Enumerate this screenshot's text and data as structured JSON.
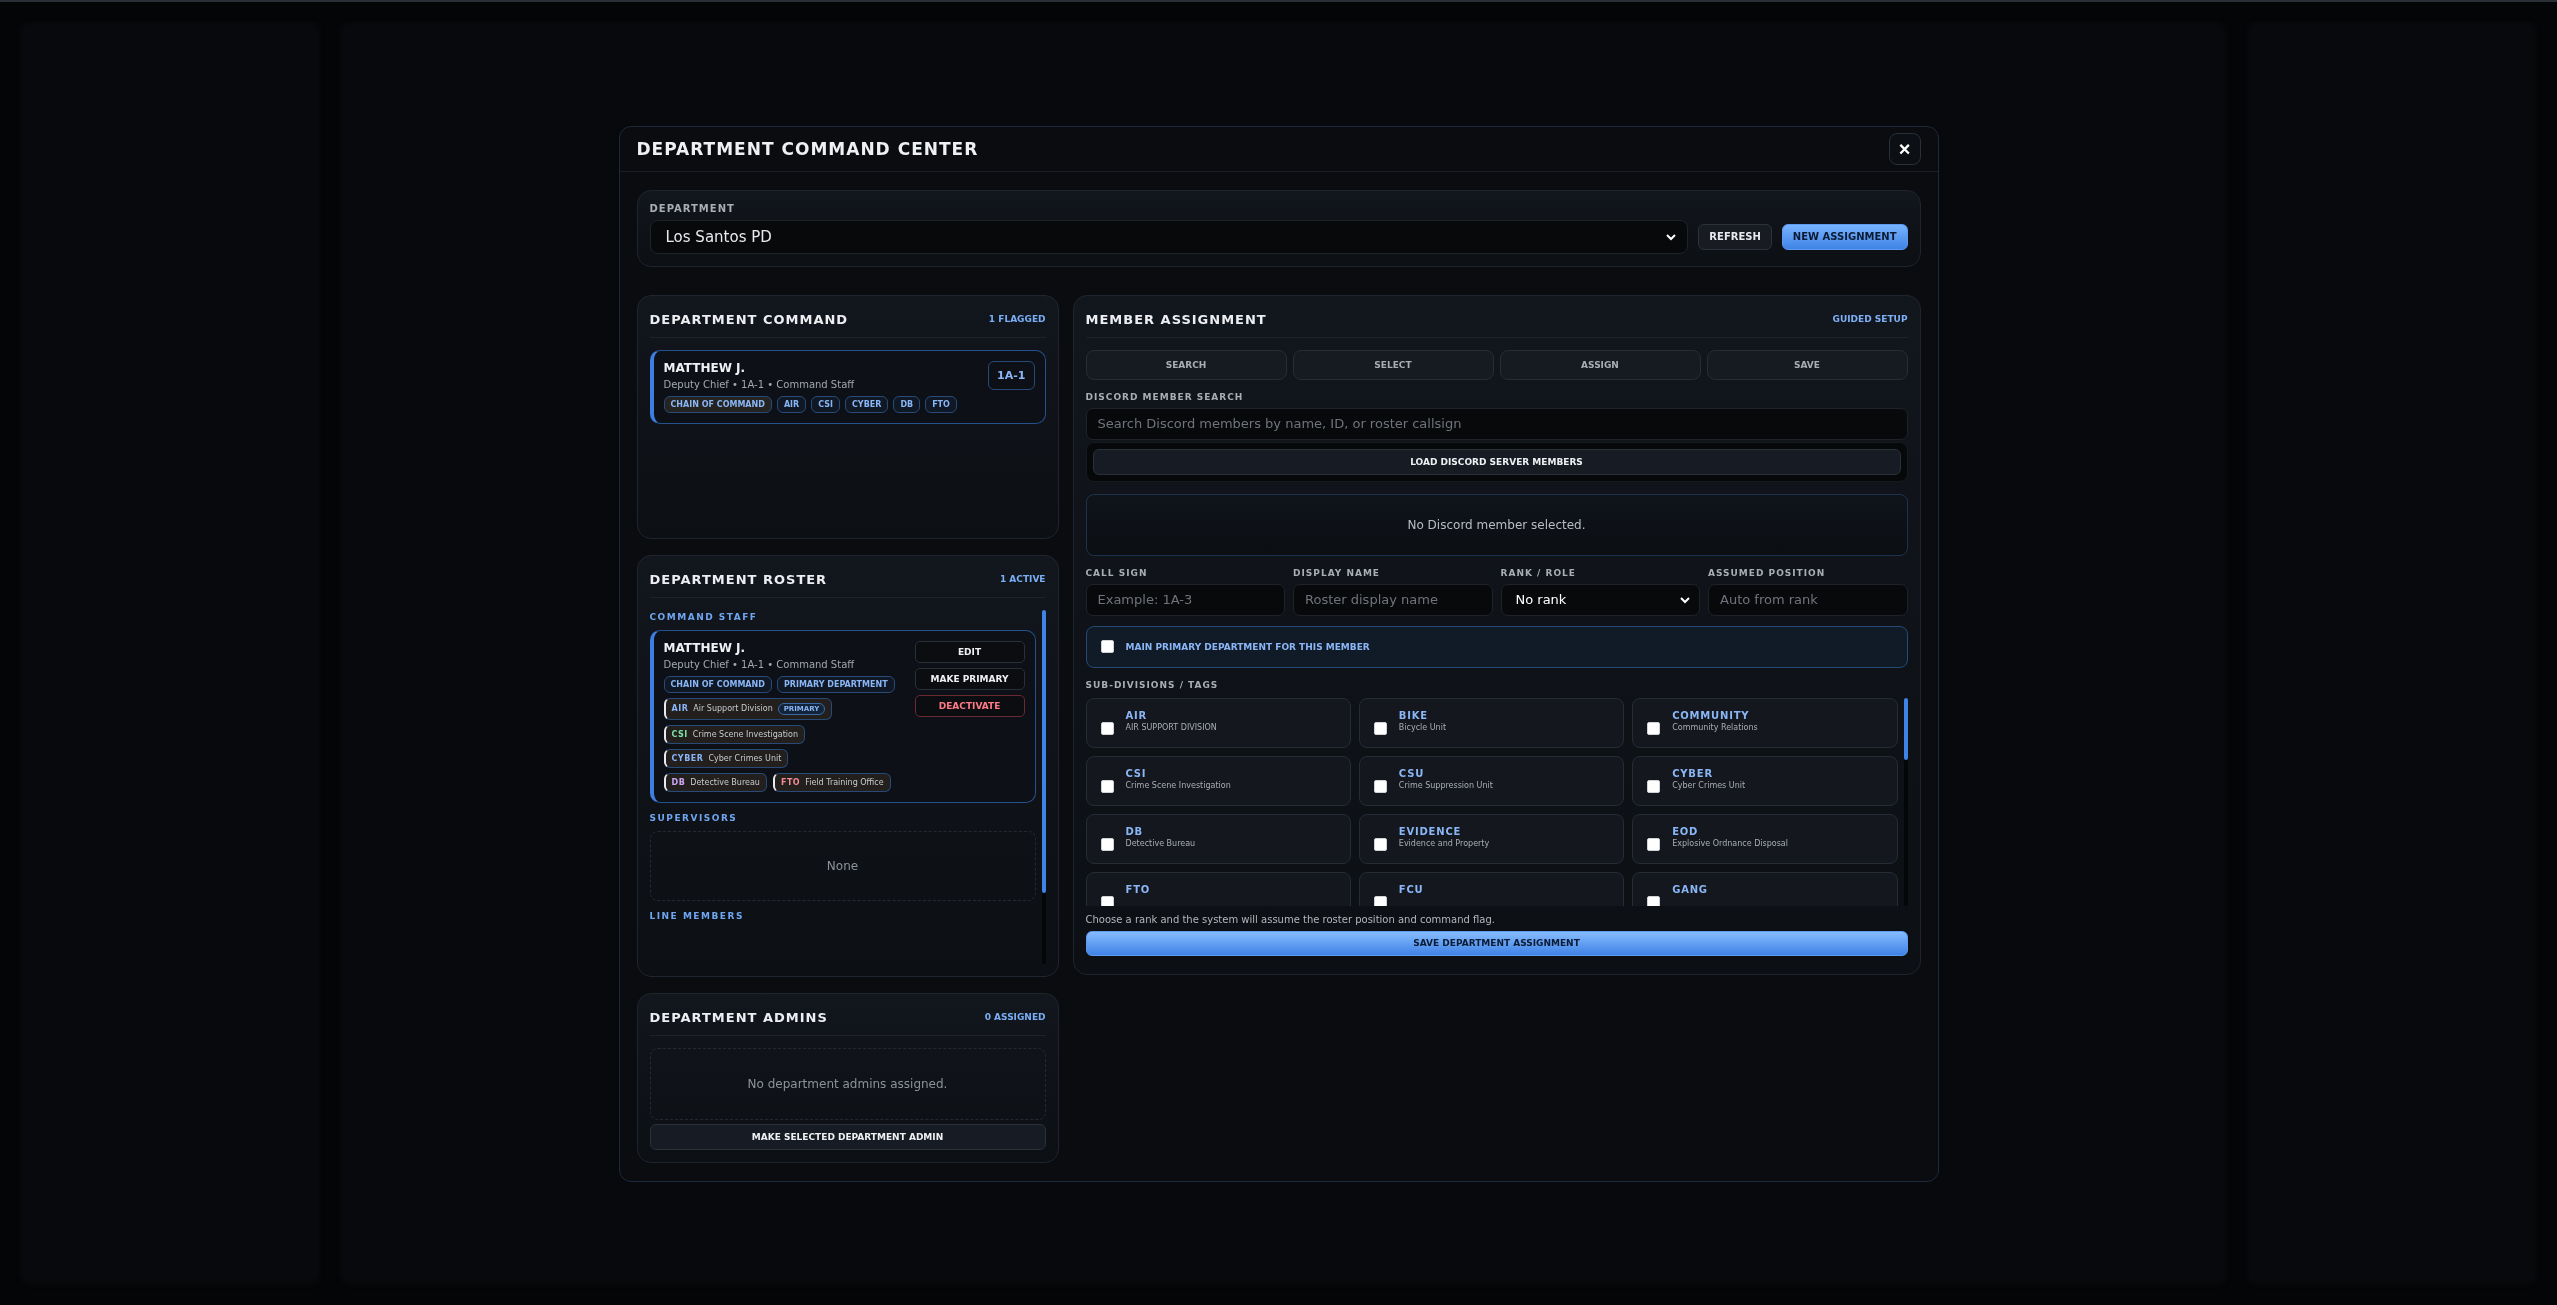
{
  "modal": {
    "title": "DEPARTMENT COMMAND CENTER",
    "close": "×"
  },
  "department": {
    "label": "DEPARTMENT",
    "value": "Los Santos PD",
    "buttons": [
      {
        "label": "REFRESH",
        "kind": "secondary"
      },
      {
        "label": "NEW ASSIGNMENT",
        "kind": "primary"
      }
    ]
  },
  "command": {
    "title": "DEPARTMENT COMMAND",
    "count": "1 FLAGGED",
    "members": [
      {
        "name": "MATTHEW J.",
        "subtitle": "Deputy Chief • 1A-1 • Command Staff",
        "callsign": "1A-1",
        "tags": [
          {
            "label": "CHAIN OF COMMAND",
            "kind": "flag"
          },
          {
            "label": "AIR",
            "kind": "division"
          },
          {
            "label": "CSI",
            "kind": "division"
          },
          {
            "label": "CYBER",
            "kind": "division"
          },
          {
            "label": "DB",
            "kind": "division"
          },
          {
            "label": "FTO",
            "kind": "division"
          }
        ]
      }
    ]
  },
  "roster": {
    "title": "DEPARTMENT ROSTER",
    "count": "1 ACTIVE",
    "groups": [
      {
        "title": "COMMAND STAFF",
        "members": [
          {
            "name": "MATTHEW J.",
            "subtitle": "Deputy Chief • 1A-1 • Command Staff",
            "badges": [
              "CHAIN OF COMMAND",
              "PRIMARY DEPARTMENT"
            ],
            "divisions": [
              {
                "code": "AIR",
                "name": "Air Support Division",
                "badge": "PRIMARY",
                "color": "#8ab4f8"
              },
              {
                "code": "CSI",
                "name": "Crime Scene Investigation",
                "color": "#7ee2a8"
              },
              {
                "code": "CYBER",
                "name": "Cyber Crimes Unit",
                "color": "#8ab4f8"
              },
              {
                "code": "DB",
                "name": "Detective Bureau",
                "color": "#c9a7f5"
              },
              {
                "code": "FTO",
                "name": "Field Training Office",
                "color": "#f28b95"
              }
            ],
            "actions": [
              {
                "label": "EDIT",
                "kind": "default"
              },
              {
                "label": "MAKE PRIMARY",
                "kind": "default"
              },
              {
                "label": "DEACTIVATE",
                "kind": "danger"
              }
            ]
          }
        ]
      },
      {
        "title": "SUPERVISORS",
        "empty": "None"
      },
      {
        "title": "LINE MEMBERS"
      }
    ]
  },
  "admins": {
    "title": "DEPARTMENT ADMINS",
    "count": "0 ASSIGNED",
    "empty": "No department admins assigned.",
    "button": "MAKE SELECTED DEPARTMENT ADMIN"
  },
  "assignment": {
    "title": "MEMBER ASSIGNMENT",
    "link": "GUIDED SETUP",
    "steps": [
      "SEARCH",
      "SELECT",
      "ASSIGN",
      "SAVE"
    ],
    "search": {
      "label": "DISCORD MEMBER SEARCH",
      "placeholder": "Search Discord members by name, ID, or roster callsign"
    },
    "load_button": "LOAD DISCORD SERVER MEMBERS",
    "selection_empty": "No Discord member selected.",
    "fields": [
      {
        "label": "CALL SIGN",
        "placeholder": "Example: 1A-3",
        "kind": "text"
      },
      {
        "label": "DISPLAY NAME",
        "placeholder": "Roster display name",
        "kind": "text"
      },
      {
        "label": "RANK / ROLE",
        "value": "No rank",
        "kind": "select"
      },
      {
        "label": "ASSUMED POSITION",
        "placeholder": "Auto from rank",
        "kind": "text"
      }
    ],
    "primary_toggle": {
      "label": "MAIN PRIMARY DEPARTMENT FOR THIS MEMBER",
      "checked": false
    },
    "tags_label": "SUB-DIVISIONS / TAGS",
    "tags": [
      {
        "code": "AIR",
        "name": "AIR SUPPORT DIVISION",
        "checked": false
      },
      {
        "code": "BIKE",
        "name": "Bicycle Unit",
        "checked": false
      },
      {
        "code": "COMMUNITY",
        "name": "Community Relations",
        "checked": false
      },
      {
        "code": "CSI",
        "name": "Crime Scene Investigation",
        "checked": false
      },
      {
        "code": "CSU",
        "name": "Crime Suppression Unit",
        "checked": false
      },
      {
        "code": "CYBER",
        "name": "Cyber Crimes Unit",
        "checked": false
      },
      {
        "code": "DB",
        "name": "Detective Bureau",
        "checked": false
      },
      {
        "code": "EVIDENCE",
        "name": "Evidence and Property",
        "checked": false
      },
      {
        "code": "EOD",
        "name": "Explosive Ordnance Disposal",
        "checked": false
      },
      {
        "code": "FTO",
        "checked": false
      },
      {
        "code": "FCU",
        "checked": false
      },
      {
        "code": "GANG",
        "checked": false
      }
    ],
    "hint": "Choose a rank and the system will assume the roster position and command flag.",
    "save": "SAVE DEPARTMENT ASSIGNMENT"
  }
}
